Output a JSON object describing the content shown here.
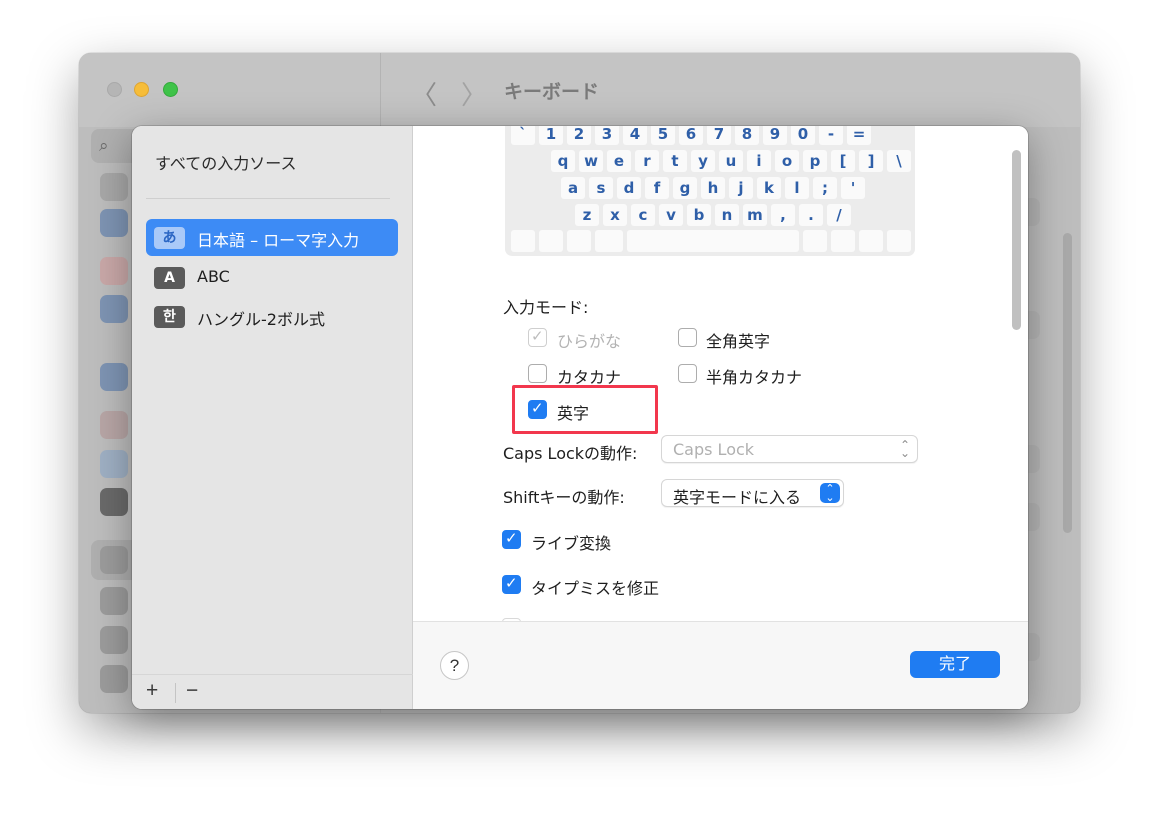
{
  "background_window": {
    "title": "キーボード",
    "nav_back": "〈",
    "nav_forward": "〉"
  },
  "sources": {
    "header": "すべての入力ソース",
    "items": [
      {
        "badge": "あ",
        "label": "日本語 – ローマ字入力",
        "selected": true
      },
      {
        "badge": "A",
        "label": "ABC",
        "selected": false
      },
      {
        "badge": "한",
        "label": "ハングル-2ボル式",
        "selected": false
      }
    ],
    "add_label": "+",
    "remove_label": "−"
  },
  "keyboard": {
    "row1": [
      "`",
      "1",
      "2",
      "3",
      "4",
      "5",
      "6",
      "7",
      "8",
      "9",
      "0",
      "-",
      "="
    ],
    "row2": [
      "q",
      "w",
      "e",
      "r",
      "t",
      "y",
      "u",
      "i",
      "o",
      "p",
      "[",
      "]",
      "\\"
    ],
    "row3": [
      "a",
      "s",
      "d",
      "f",
      "g",
      "h",
      "j",
      "k",
      "l",
      ";",
      "'"
    ],
    "row4": [
      "z",
      "x",
      "c",
      "v",
      "b",
      "n",
      "m",
      ",",
      ".",
      "/"
    ]
  },
  "input_mode": {
    "label": "入力モード:",
    "options": {
      "hiragana": {
        "label": "ひらがな",
        "checked": true,
        "disabled": true
      },
      "fullwidth_roman": {
        "label": "全角英字",
        "checked": false
      },
      "katakana": {
        "label": "カタカナ",
        "checked": false
      },
      "halfwidth_katakana": {
        "label": "半角カタカナ",
        "checked": false
      },
      "romaji": {
        "label": "英字",
        "checked": true
      }
    }
  },
  "caps_lock": {
    "label": "Caps Lockの動作:",
    "value": "Caps Lock"
  },
  "shift": {
    "label": "Shiftキーの動作:",
    "value": "英字モードに入る"
  },
  "options": {
    "live_conversion": {
      "label": "ライブ変換",
      "checked": true
    },
    "typo_correction": {
      "label": "タイプミスを修正",
      "checked": true
    }
  },
  "footer": {
    "help_label": "?",
    "done_label": "完了"
  },
  "colors": {
    "accent": "#1f7cf2",
    "highlight": "#f2374d",
    "selection": "#3d8bf5"
  }
}
